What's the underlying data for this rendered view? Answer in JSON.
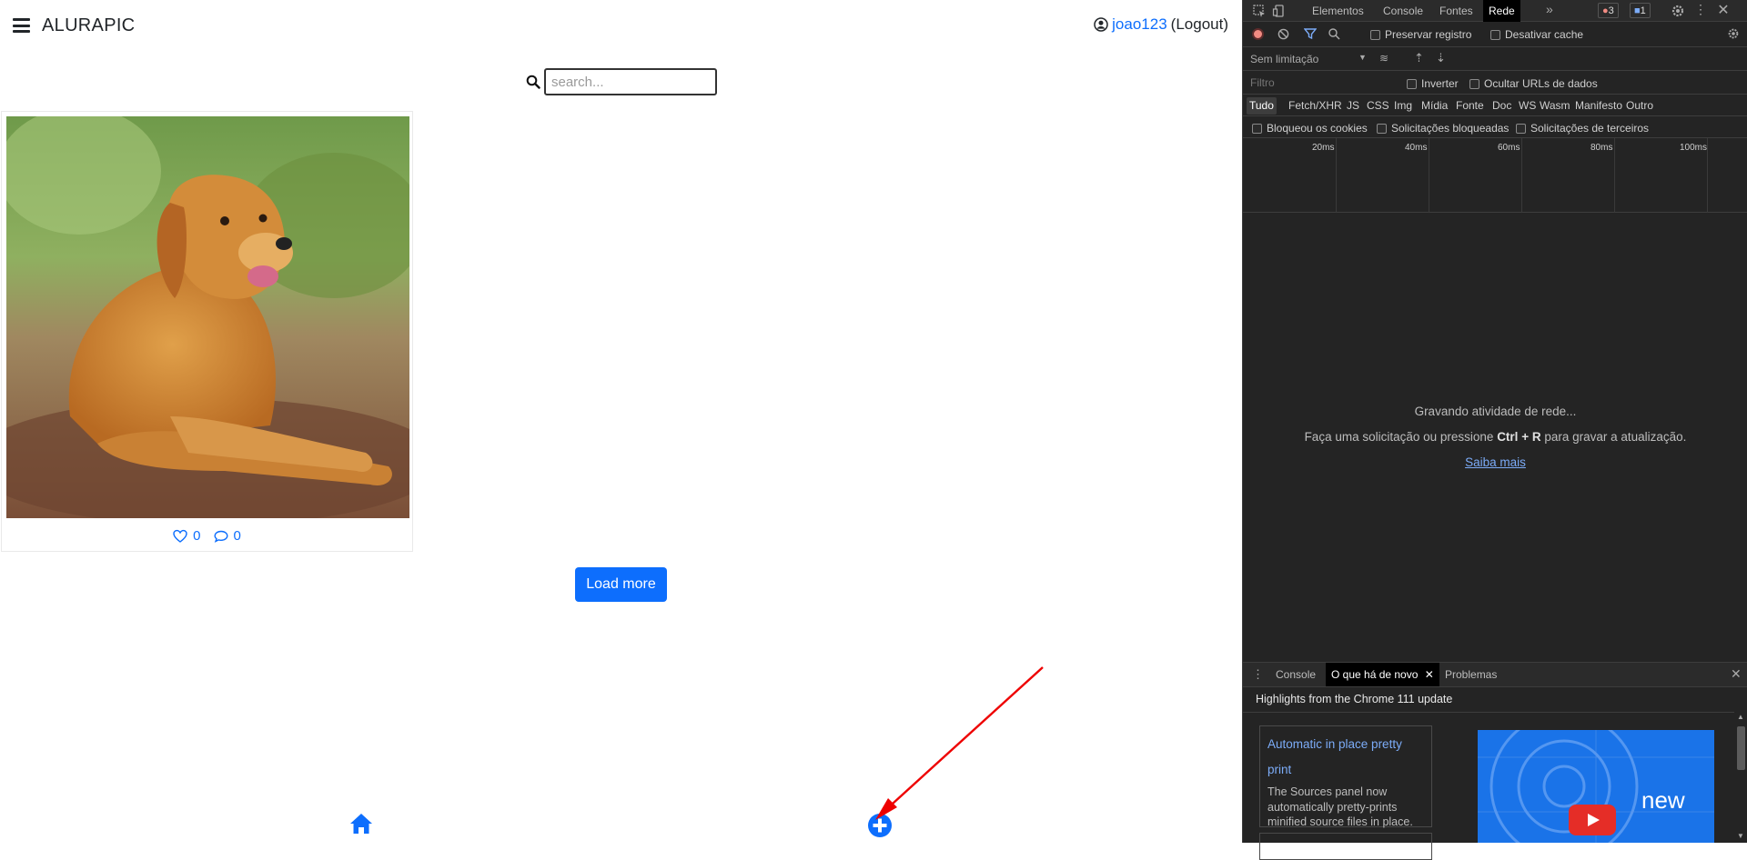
{
  "app": {
    "brand": "ALURAPIC",
    "username": "joao123",
    "logout_label": "(Logout)",
    "search_placeholder": "search...",
    "likes_count": "0",
    "comments_count": "0",
    "load_more_label": "Load more",
    "colors": {
      "primary": "#0d6efd",
      "arrow": "#ee0000"
    },
    "photo_icon": "golden-retriever-photo"
  },
  "devtools": {
    "tabs": [
      "Elementos",
      "Console",
      "Fontes",
      "Rede"
    ],
    "active_tab": "Rede",
    "error_count": "3",
    "message_count": "1",
    "preserve_log_label": "Preservar registro",
    "disable_cache_label": "Desativar cache",
    "throttle_label": "Sem limitação",
    "filter_placeholder": "Filtro",
    "invert_label": "Inverter",
    "hide_data_urls_label": "Ocultar URLs de dados",
    "filter_types": [
      "Tudo",
      "Fetch/XHR",
      "JS",
      "CSS",
      "Img",
      "Mídia",
      "Fonte",
      "Doc",
      "WS",
      "Wasm",
      "Manifesto",
      "Outro"
    ],
    "blocked_cookies_label": "Bloqueou os cookies",
    "blocked_requests_label": "Solicitações bloqueadas",
    "third_party_label": "Solicitações de terceiros",
    "timeline_labels": [
      "20ms",
      "40ms",
      "60ms",
      "80ms",
      "100ms"
    ],
    "recording_msg": "Gravando atividade de rede...",
    "hint_before": "Faça uma solicitação ou pressione ",
    "hint_key": "Ctrl + R",
    "hint_after": " para gravar a atualização.",
    "learn_more": "Saiba mais",
    "drawer_tabs": [
      "Console",
      "O que há de novo",
      "Problemas"
    ],
    "drawer_active": "O que há de novo",
    "highlights_title": "Highlights from the Chrome 111 update",
    "feature_title": "Automatic in place pretty print",
    "feature_desc": "The Sources panel now automatically pretty-prints minified source files in place.",
    "promo_text": "new"
  }
}
